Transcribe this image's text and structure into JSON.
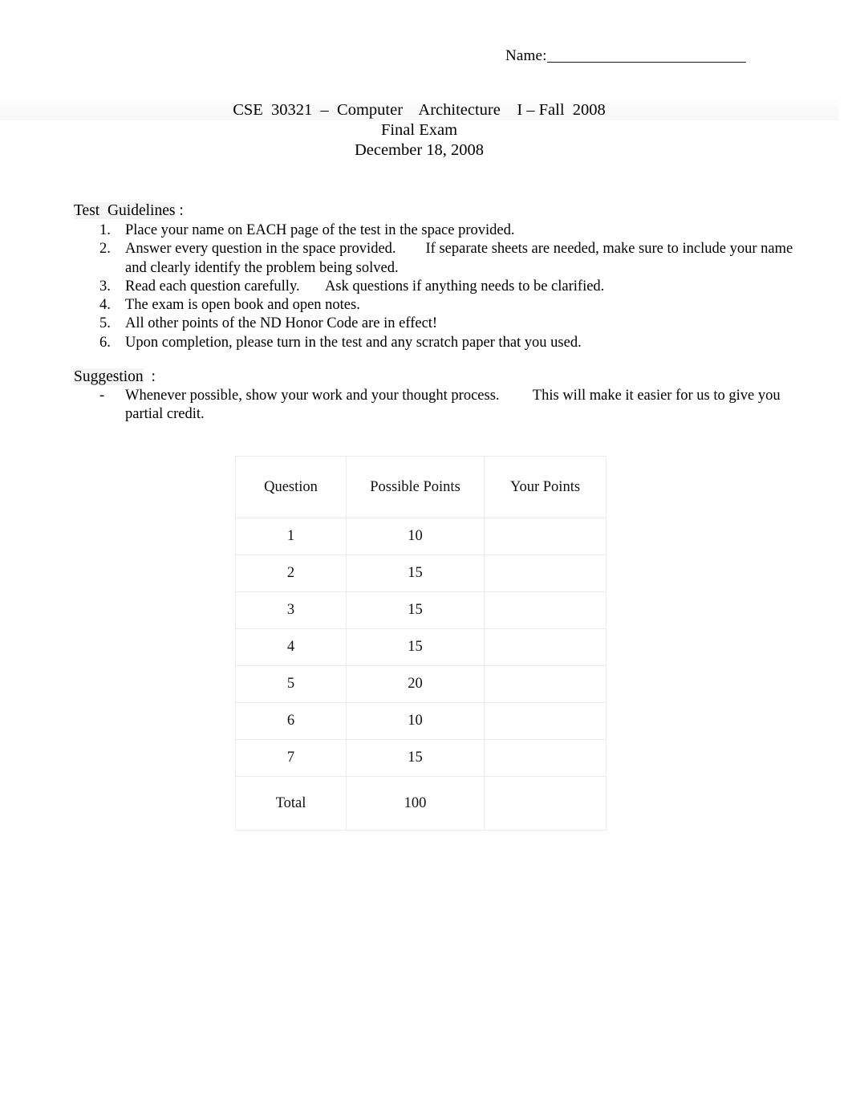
{
  "name_field": {
    "label": "Name:",
    "value": ""
  },
  "title": {
    "line1": "CSE  30321  –  Computer    Architecture    I – Fall  2008",
    "line2": "Final Exam",
    "line3": "December 18, 2008"
  },
  "guidelines_section": {
    "heading_text": "Test  Guidelines",
    "heading_colon": " :",
    "items": [
      {
        "num": "1.",
        "text": "Place your name on EACH page of the test in the space provided."
      },
      {
        "num": "2.",
        "text": "Answer every question in the space provided.        If separate sheets are needed, make sure to include your name and clearly identify the problem being solved."
      },
      {
        "num": "3.",
        "text": "Read each question carefully.       Ask questions if anything needs to be clarified."
      },
      {
        "num": "4.",
        "text": "The exam is open book and open notes."
      },
      {
        "num": "5.",
        "text": "All other points of the ND Honor Code are in effect!"
      },
      {
        "num": "6.",
        "text": "Upon completion, please turn in the test and any scratch paper that you used."
      }
    ]
  },
  "suggestion_section": {
    "heading_text": "Suggestion",
    "heading_colon": "  :",
    "items": [
      {
        "bullet": "-",
        "text": "Whenever possible, show your work and your thought process.         This will make it easier for us to give you partial credit."
      }
    ]
  },
  "grade_table": {
    "headers": [
      "Question",
      "Possible Points",
      "Your Points"
    ],
    "rows": [
      {
        "question": "1",
        "possible_points": "10",
        "your_points": ""
      },
      {
        "question": "2",
        "possible_points": "15",
        "your_points": ""
      },
      {
        "question": "3",
        "possible_points": "15",
        "your_points": ""
      },
      {
        "question": "4",
        "possible_points": "15",
        "your_points": ""
      },
      {
        "question": "5",
        "possible_points": "20",
        "your_points": ""
      },
      {
        "question": "6",
        "possible_points": "10",
        "your_points": ""
      },
      {
        "question": "7",
        "possible_points": "15",
        "your_points": ""
      }
    ],
    "total_row": {
      "question": "Total",
      "possible_points": "100",
      "your_points": ""
    }
  },
  "colors": {
    "page_background": "#ffffff",
    "text": "#000000",
    "table_border": "#ebebeb",
    "heading_shade": "#f4f4f4"
  }
}
